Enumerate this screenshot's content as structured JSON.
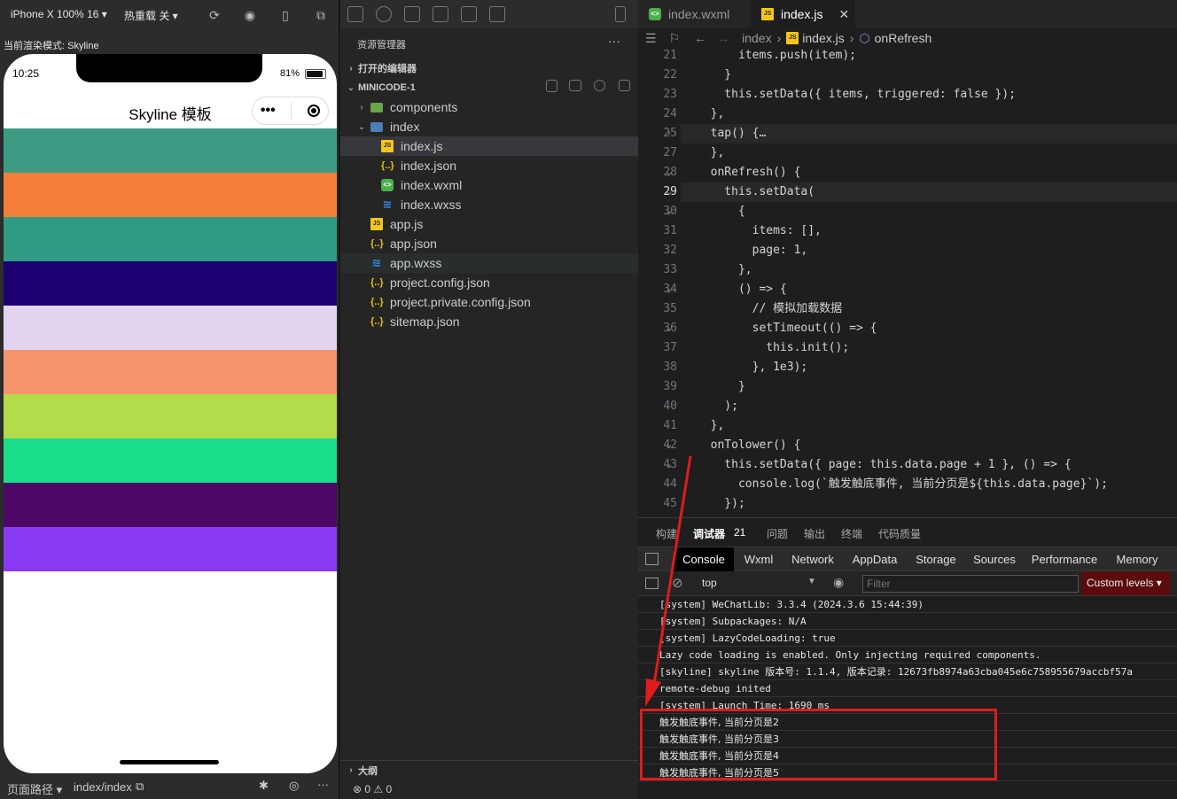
{
  "simulator": {
    "device": "iPhone X 100% 16 ▾",
    "hot_reload": "热重载 关 ▾",
    "render_mode": "当前渲染模式: Skyline",
    "status_time": "10:25",
    "battery": "81%",
    "nav_title": "Skyline 模板",
    "bar_colors": [
      "#3d9b84",
      "#f57f38",
      "#2f9b84",
      "#1c0071",
      "#e3d5f0",
      "#f4946c",
      "#b2dc4b",
      "#1ade8c",
      "#4d0765",
      "#8a3af3"
    ],
    "footer_path_label": "页面路径 ▾",
    "footer_path": "index/index"
  },
  "explorer": {
    "title": "资源管理器",
    "more": "···",
    "open_editors": "打开的编辑器",
    "project": "MINICODE-1",
    "tree": [
      {
        "name": "components",
        "type": "folder",
        "depth": 1,
        "chev": "›"
      },
      {
        "name": "index",
        "type": "ofolder",
        "depth": 1,
        "chev": "⌄"
      },
      {
        "name": "index.js",
        "type": "js",
        "depth": 2,
        "chev": ""
      },
      {
        "name": "index.json",
        "type": "json",
        "depth": 2,
        "chev": ""
      },
      {
        "name": "index.wxml",
        "type": "wxml",
        "depth": 2,
        "chev": ""
      },
      {
        "name": "index.wxss",
        "type": "wxss",
        "depth": 2,
        "chev": ""
      },
      {
        "name": "app.js",
        "type": "js",
        "depth": 1,
        "chev": ""
      },
      {
        "name": "app.json",
        "type": "json",
        "depth": 1,
        "chev": ""
      },
      {
        "name": "app.wxss",
        "type": "wxss",
        "depth": 1,
        "chev": ""
      },
      {
        "name": "project.config.json",
        "type": "json",
        "depth": 1,
        "chev": ""
      },
      {
        "name": "project.private.config.json",
        "type": "json",
        "depth": 1,
        "chev": ""
      },
      {
        "name": "sitemap.json",
        "type": "json",
        "depth": 1,
        "chev": ""
      }
    ],
    "outline": "大纲",
    "problems": "⊗ 0 ⚠ 0"
  },
  "editor": {
    "tabs": [
      {
        "label": "index.wxml"
      },
      {
        "label": "index.js"
      }
    ],
    "breadcrumb": {
      "folder": "index",
      "file": "index.js",
      "symbol": "onRefresh"
    },
    "line_numbers": [
      "21",
      "22",
      "23",
      "24",
      "25",
      "27",
      "28",
      "29",
      "30",
      "31",
      "32",
      "33",
      "34",
      "35",
      "36",
      "37",
      "38",
      "39",
      "40",
      "41",
      "42",
      "43",
      "44",
      "45"
    ],
    "code_lines": [
      "      items.push(item);",
      "    }",
      "    this.setData({ items, triggered: false });",
      "  },",
      "  tap() {…",
      "  },",
      "  onRefresh() {",
      "    this.setData(",
      "      {",
      "        items: [],",
      "        page: 1,",
      "      },",
      "      () => {",
      "        // 模拟加载数据",
      "        setTimeout(() => {",
      "          this.init();",
      "        }, 1e3);",
      "      }",
      "    );",
      "  },",
      "  onTolower() {",
      "    this.setData({ page: this.data.page + 1 }, () => {",
      "      console.log(`触发触底事件, 当前分页是${this.data.page}`);",
      "    });"
    ]
  },
  "panel": {
    "tabs": [
      "构建",
      "调试器",
      "21",
      "问题",
      "输出",
      "终端",
      "代码质量"
    ],
    "devtools_tabs": [
      "Console",
      "Wxml",
      "Network",
      "AppData",
      "Storage",
      "Sources",
      "Performance",
      "Memory"
    ],
    "context": "top",
    "filter_placeholder": "Filter",
    "levels": "Custom levels ▾",
    "console_lines": [
      "[system] WeChatLib: 3.3.4 (2024.3.6 15:44:39)",
      "[system] Subpackages: N/A",
      "[system] LazyCodeLoading: true",
      "Lazy code loading is enabled. Only injecting required components.",
      "[skyline] skyline 版本号: 1.1.4, 版本记录: 12673fb8974a63cba045e6c758955679accbf57a",
      "remote-debug inited",
      "[system] Launch Time: 1690 ms",
      "触发触底事件, 当前分页是2",
      "触发触底事件, 当前分页是3",
      "触发触底事件, 当前分页是4",
      "触发触底事件, 当前分页是5"
    ]
  },
  "colors": {
    "highlight": "#e01b1b",
    "accent": "#0e639c"
  }
}
